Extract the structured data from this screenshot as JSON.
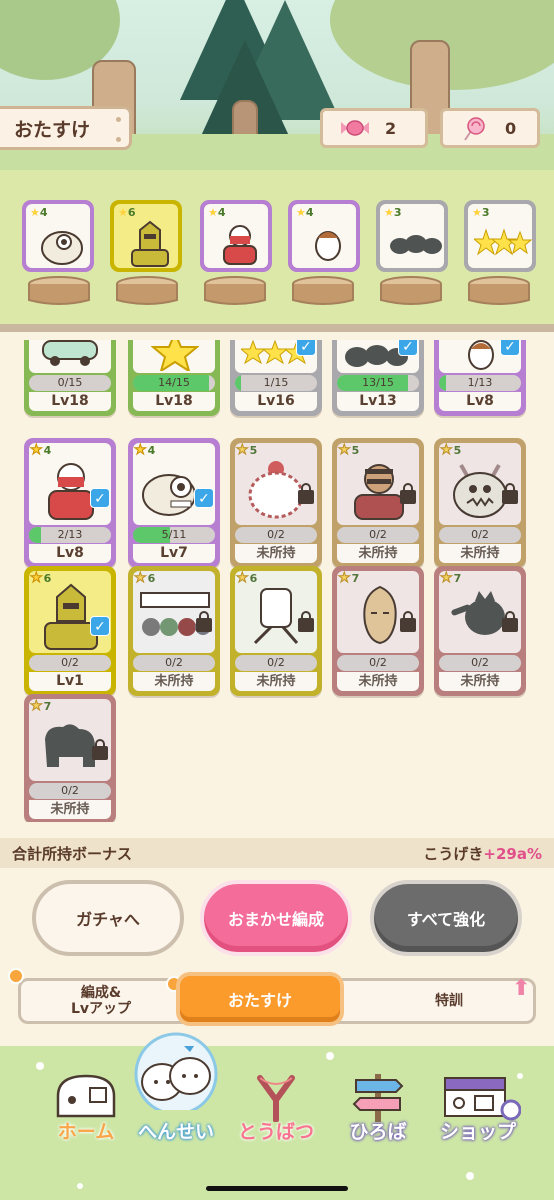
{
  "header": {
    "title": "おたすけ"
  },
  "currencies": [
    {
      "icon": "candy-icon",
      "value": "2"
    },
    {
      "icon": "lollipop-icon",
      "value": "0"
    }
  ],
  "team": [
    {
      "stars": "4",
      "rarity": "purple"
    },
    {
      "stars": "6",
      "rarity": "yellow"
    },
    {
      "stars": "4",
      "rarity": "purple"
    },
    {
      "stars": "4",
      "rarity": "purple"
    },
    {
      "stars": "3",
      "rarity": "gray"
    },
    {
      "stars": "3",
      "rarity": "gray"
    }
  ],
  "cards": [
    {
      "stars": "",
      "progress": "0/15",
      "level": "Lv18",
      "rarity": "green",
      "checked": false,
      "locked": false,
      "fill": 0
    },
    {
      "stars": "",
      "progress": "14/15",
      "level": "Lv18",
      "rarity": "green",
      "checked": false,
      "locked": false,
      "fill": 0.93
    },
    {
      "stars": "",
      "progress": "1/15",
      "level": "Lv16",
      "rarity": "gray",
      "checked": true,
      "locked": false,
      "fill": 0.07
    },
    {
      "stars": "",
      "progress": "13/15",
      "level": "Lv13",
      "rarity": "gray",
      "checked": true,
      "locked": false,
      "fill": 0.87
    },
    {
      "stars": "",
      "progress": "1/13",
      "level": "Lv8",
      "rarity": "purple",
      "checked": true,
      "locked": false,
      "fill": 0.08
    },
    {
      "stars": "4",
      "progress": "2/13",
      "level": "Lv8",
      "rarity": "purple",
      "checked": true,
      "locked": false,
      "fill": 0.15
    },
    {
      "stars": "4",
      "progress": "5/11",
      "level": "Lv7",
      "rarity": "purple",
      "checked": true,
      "locked": false,
      "fill": 0.45
    },
    {
      "stars": "5",
      "progress": "0/2",
      "level": "未所持",
      "rarity": "gold",
      "checked": false,
      "locked": true,
      "fill": 0
    },
    {
      "stars": "5",
      "progress": "0/2",
      "level": "未所持",
      "rarity": "gold",
      "checked": false,
      "locked": true,
      "fill": 0
    },
    {
      "stars": "5",
      "progress": "0/2",
      "level": "未所持",
      "rarity": "gold",
      "checked": false,
      "locked": true,
      "fill": 0
    },
    {
      "stars": "6",
      "progress": "0/2",
      "level": "Lv1",
      "rarity": "yellow",
      "checked": true,
      "locked": false,
      "fill": 0
    },
    {
      "stars": "6",
      "progress": "0/2",
      "level": "未所持",
      "rarity": "yellow",
      "checked": false,
      "locked": true,
      "fill": 0
    },
    {
      "stars": "6",
      "progress": "0/2",
      "level": "未所持",
      "rarity": "yellow",
      "checked": false,
      "locked": true,
      "fill": 0
    },
    {
      "stars": "7",
      "progress": "0/2",
      "level": "未所持",
      "rarity": "red",
      "checked": false,
      "locked": true,
      "fill": 0
    },
    {
      "stars": "7",
      "progress": "0/2",
      "level": "未所持",
      "rarity": "red",
      "checked": false,
      "locked": true,
      "fill": 0
    },
    {
      "stars": "7",
      "progress": "0/2",
      "level": "未所持",
      "rarity": "red",
      "checked": false,
      "locked": true,
      "fill": 0
    }
  ],
  "bonus": {
    "label": "合計所持ボーナス",
    "stat": "こうげき",
    "value": "+29a%"
  },
  "buttons": {
    "gacha": "ガチャへ",
    "auto": "おまかせ編成",
    "upgrade_all": "すべて強化"
  },
  "tabs": {
    "formation": "編成&\nLvアップ",
    "helper": "おたすけ",
    "training": "特訓"
  },
  "nav": [
    {
      "label": "ホーム",
      "icon": "house-icon"
    },
    {
      "label": "へんせい",
      "icon": "characters-icon"
    },
    {
      "label": "とうばつ",
      "icon": "slingshot-icon"
    },
    {
      "label": "ひろば",
      "icon": "signpost-icon"
    },
    {
      "label": "ショップ",
      "icon": "shop-icon"
    }
  ],
  "colors": {
    "purple": "#b67fd2",
    "yellow": "#c9b400",
    "gold": "#caa055",
    "green": "#86b854",
    "red": "#c87a7a",
    "gray": "#a9a9ad",
    "accent_pink": "#f46c99",
    "accent_orange": "#fb9b2c"
  }
}
